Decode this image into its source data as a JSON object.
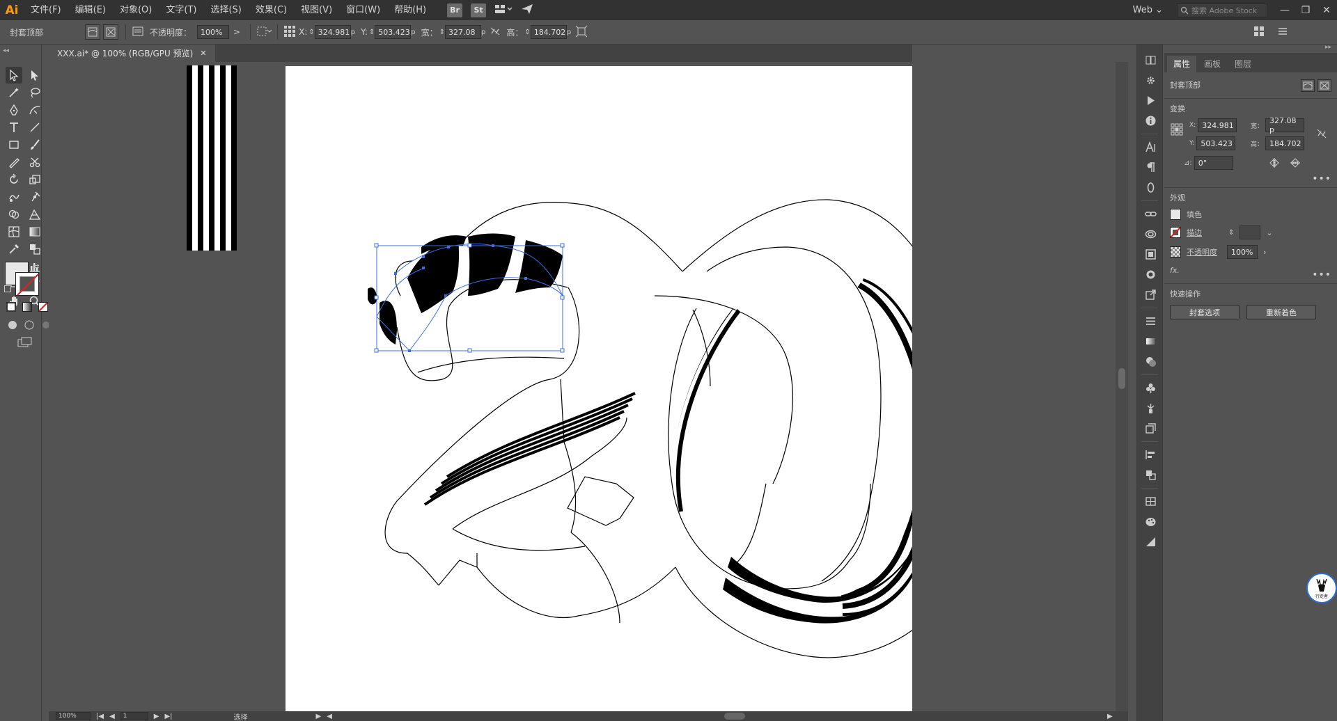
{
  "app": {
    "logo": "Ai"
  },
  "menu": [
    "文件(F)",
    "编辑(E)",
    "对象(O)",
    "文字(T)",
    "选择(S)",
    "效果(C)",
    "视图(V)",
    "窗口(W)",
    "帮助(H)"
  ],
  "menu_icons": {
    "br": "Br",
    "st": "St"
  },
  "workspace": {
    "label": "Web",
    "chevron": "⌄"
  },
  "stock_search": {
    "placeholder": "搜索 Adobe Stock"
  },
  "window_controls": {
    "minimize": "—",
    "restore": "❐",
    "close": "✕"
  },
  "control_bar": {
    "selection_label": "封套顶部",
    "opacity_label": "不透明度：",
    "opacity_value": "100%",
    "opacity_arrow": ">",
    "x_label": "X:",
    "x_value": "324.981",
    "y_label": "Y:",
    "y_value": "503.423",
    "w_label": "宽：",
    "w_value": "327.08",
    "h_label": "高：",
    "h_value": "184.702",
    "unit_suffix": "p"
  },
  "document_tab": {
    "title": "XXX.ai* @ 100% (RGB/GPU 预览)",
    "close": "✕"
  },
  "status_bar": {
    "zoom": "100%",
    "artboard_number": "1",
    "tool_name": "选择",
    "nav_first": "|◀",
    "nav_prev": "◀",
    "nav_next": "▶",
    "nav_last": "▶|",
    "play": "▶",
    "scroll_left": "◀",
    "scroll_right": "▶"
  },
  "properties_panel": {
    "tabs": [
      "属性",
      "画板",
      "图层"
    ],
    "selection_type": "封套顶部",
    "transform_title": "变换",
    "x_label": "X:",
    "x_value": "324.981",
    "y_label": "Y:",
    "y_value": "503.423",
    "w_label": "宽：",
    "w_value": "327.08 p",
    "h_label": "高：",
    "h_value": "184.702",
    "angle_label": "⊿:",
    "angle_value": "0°",
    "appearance_title": "外观",
    "fill_label": "填色",
    "stroke_label": "描边",
    "opacity_label": "不透明度",
    "opacity_value": "100%",
    "fx_label": "fx.",
    "quick_actions_title": "快速操作",
    "btn_envelope_options": "封套选项",
    "btn_recolor": "重新着色",
    "more": "•••"
  },
  "watermark": {
    "label": "行走者"
  },
  "colors": {
    "ui_dark": "#323232",
    "ui_mid": "#535353",
    "ui_panel_dark": "#424242",
    "selection_blue": "#3d6ee0",
    "accent_orange": "#ff9a00"
  }
}
